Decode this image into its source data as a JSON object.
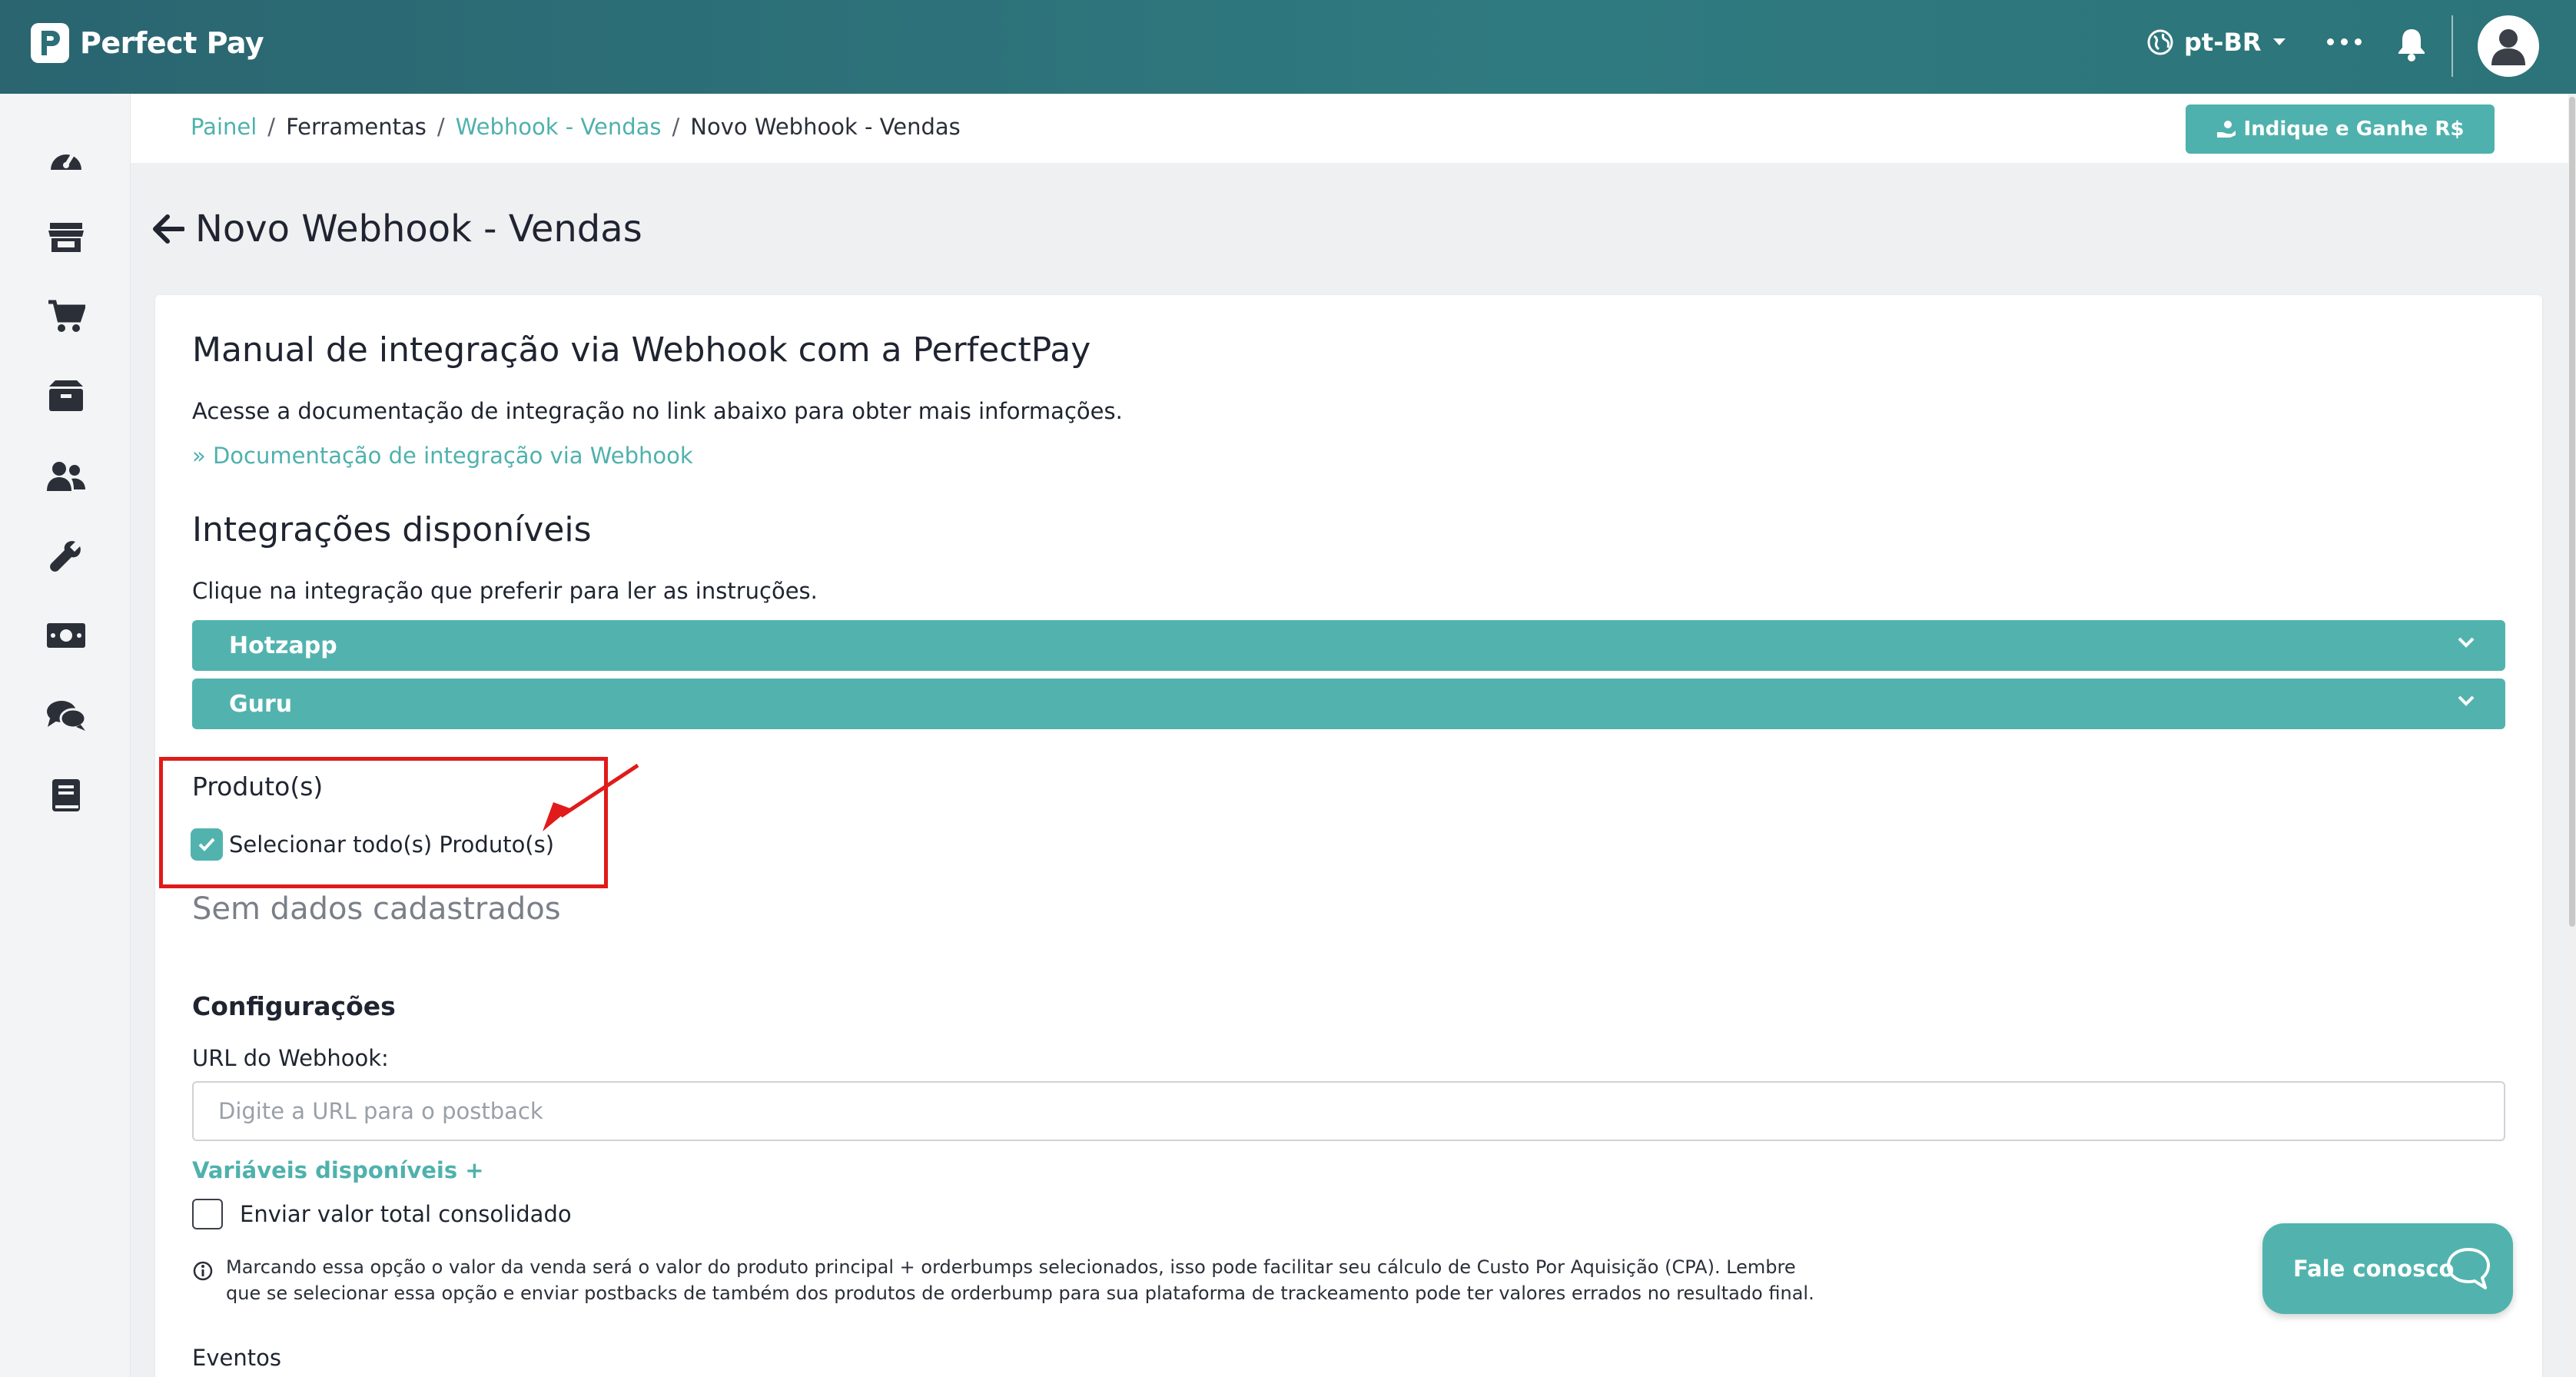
{
  "header": {
    "logo_text": "Perfect Pay",
    "language": "pt-BR"
  },
  "breadcrumb": [
    {
      "label": "Painel",
      "link": true
    },
    {
      "label": "Ferramentas",
      "link": false
    },
    {
      "label": "Webhook - Vendas",
      "link": true
    },
    {
      "label": "Novo Webhook - Vendas",
      "link": false
    }
  ],
  "refer_button": "Indique e Ganhe R$",
  "page_title": "Novo Webhook - Vendas",
  "manual": {
    "title": "Manual de integração via Webhook com a PerfectPay",
    "description": "Acesse a documentação de integração no link abaixo para obter mais informações.",
    "doc_link": "» Documentação de integração via Webhook"
  },
  "integrations": {
    "title": "Integrações disponíveis",
    "description": "Clique na integração que preferir para ler as instruções.",
    "items": [
      "Hotzapp",
      "Guru"
    ]
  },
  "products": {
    "label": "Produto(s)",
    "select_all": "Selecionar todo(s) Produto(s)",
    "select_all_checked": true,
    "empty": "Sem dados cadastrados"
  },
  "config": {
    "title": "Configurações",
    "url_label": "URL do Webhook:",
    "url_placeholder": "Digite a URL para o postback",
    "url_value": "",
    "variables_link": "Variáveis disponíveis +",
    "consolidated_label": "Enviar valor total consolidado",
    "consolidated_checked": false,
    "info_line1": "Marcando essa opção o valor da venda será o valor do produto principal + orderbumps selecionados, isso pode facilitar seu cálculo de Custo Por Aquisição (CPA). Lembre",
    "info_line2": "que se selecionar essa opção e enviar postbacks de também dos produtos de orderbump para sua plataforma de trackeamento pode ter valores errados no resultado final."
  },
  "events_label": "Eventos",
  "chat_button": "Fale conosco",
  "colors": {
    "teal": "#52b3ae",
    "header": "#2c6f76",
    "highlight": "#e11a1a"
  }
}
